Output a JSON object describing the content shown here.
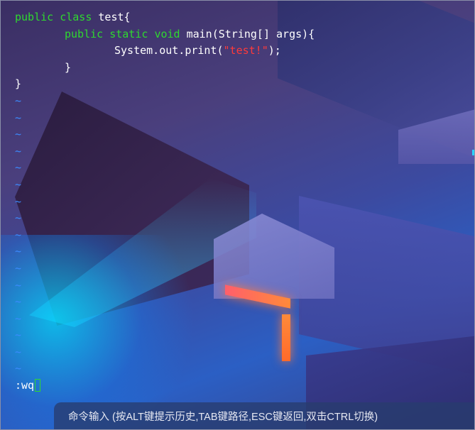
{
  "editor": {
    "lines": {
      "l1_kw1": "public",
      "l1_kw2": "class",
      "l1_rest": " test{",
      "l2_kw1": "public",
      "l2_kw2": "static",
      "l2_kw3": "void",
      "l2_rest": " main(String[] args){",
      "l3_pre": "System.out.print(",
      "l3_str": "\"test!\"",
      "l3_post": ");",
      "l4": "}",
      "l5": "}"
    },
    "empty_line_marker": "~",
    "empty_line_count": 17,
    "command": ":wq"
  },
  "hint_bar": {
    "text": "命令输入 (按ALT键提示历史,TAB键路径,ESC键返回,双击CTRL切换)"
  },
  "colors": {
    "keyword": "#2fd82f",
    "string": "#ff3a3a",
    "tilde": "#3c8bff",
    "text": "#ffffff"
  }
}
